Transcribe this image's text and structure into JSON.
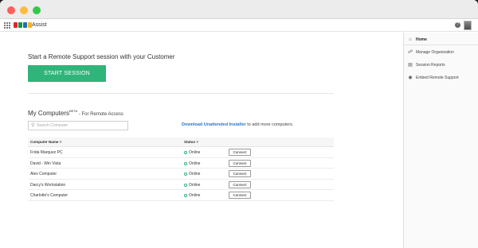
{
  "app": {
    "name": "Assist",
    "logo_colors": [
      "#e42527",
      "#089949",
      "#226db4",
      "#f9b21d"
    ]
  },
  "sidebar": {
    "items": [
      {
        "label": "Home",
        "icon": "home-icon"
      },
      {
        "label": "Manage Organization",
        "icon": "organization-icon"
      },
      {
        "label": "Session Reports",
        "icon": "reports-icon"
      },
      {
        "label": "Embed Remote Support",
        "icon": "embed-icon"
      }
    ]
  },
  "remote": {
    "title": "Start a Remote Support session with your Customer",
    "start_label": "START SESSION"
  },
  "my_computers": {
    "title": "My Computers",
    "beta": "BETA",
    "subtitle": " - For Remote Access",
    "search_placeholder": "Search Computer",
    "download_link": "Download Unattended Installer",
    "download_suffix": " to add more computers."
  },
  "table": {
    "headers": [
      "Computer Name ˅",
      "Status ˅"
    ],
    "rows": [
      {
        "name": "Frida Marquez PC",
        "status": "Online",
        "action": "Connect"
      },
      {
        "name": "David - Win Vista",
        "status": "Online",
        "action": "Connect"
      },
      {
        "name": "Alex Computer",
        "status": "Online",
        "action": "Connect"
      },
      {
        "name": "Darcy's Workstation",
        "status": "Online",
        "action": "Connect"
      },
      {
        "name": "Charlotte's Computer",
        "status": "Online",
        "action": "Connect"
      }
    ]
  },
  "colors": {
    "accent": "#2fb57a",
    "link": "#2a75c8"
  }
}
